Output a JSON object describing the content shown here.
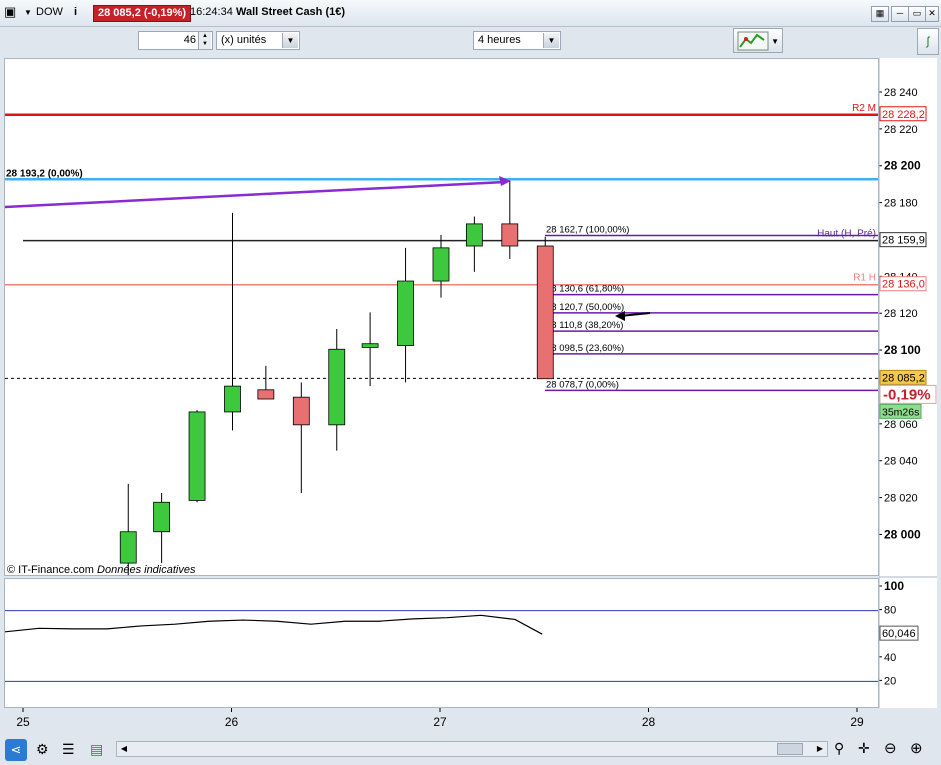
{
  "title_bar": {
    "symbol": "DOW",
    "info_icon": "info-icon",
    "price_change": "28 085,2 (-0,19%)",
    "time": "16:24:34",
    "instrument": "Wall Street Cash (1€)"
  },
  "toolbar": {
    "quantity_value": "46",
    "unit_label": "(x) unités",
    "timeframe_label": "4 heures",
    "strategy_icon": "chart-strategy-icon"
  },
  "chart_data": {
    "type": "candlestick",
    "y_axis_labels": [
      "28 240",
      "28 220",
      "28 200",
      "28 180",
      "28 160",
      "28 140",
      "28 120",
      "28 100",
      "28 060",
      "28 040",
      "28 020",
      "28 000"
    ],
    "x_axis_labels": [
      "25",
      "26",
      "27",
      "28",
      "29"
    ],
    "ylim": [
      27990,
      28250
    ],
    "candles": [
      {
        "x": 25.5,
        "open": 27985,
        "high": 28028,
        "low": 27975,
        "close": 28002
      },
      {
        "x": 25.66,
        "open": 28002,
        "high": 28023,
        "low": 27985,
        "close": 28018
      },
      {
        "x": 25.83,
        "open": 28019,
        "high": 28068,
        "low": 28018,
        "close": 28067
      },
      {
        "x": 26.0,
        "open": 28067,
        "high": 28175,
        "low": 28057,
        "close": 28081
      },
      {
        "x": 26.16,
        "open": 28079,
        "high": 28092,
        "low": 28074,
        "close": 28074
      },
      {
        "x": 26.33,
        "open": 28075,
        "high": 28083,
        "low": 28023,
        "close": 28060
      },
      {
        "x": 26.5,
        "open": 28060,
        "high": 28112,
        "low": 28046,
        "close": 28101
      },
      {
        "x": 26.66,
        "open": 28102,
        "high": 28121,
        "low": 28081,
        "close": 28104
      },
      {
        "x": 26.83,
        "open": 28103,
        "high": 28156,
        "low": 28083,
        "close": 28138
      },
      {
        "x": 27.0,
        "open": 28138,
        "high": 28163,
        "low": 28129,
        "close": 28156
      },
      {
        "x": 27.16,
        "open": 28157,
        "high": 28173,
        "low": 28143,
        "close": 28169
      },
      {
        "x": 27.33,
        "open": 28169,
        "high": 28192,
        "low": 28150,
        "close": 28157
      },
      {
        "x": 27.5,
        "open": 28157,
        "high": 28162,
        "low": 28085,
        "close": 28085
      }
    ],
    "levels": [
      {
        "name": "R2 M",
        "value": 28228.2,
        "label": "28 228,2",
        "color": "#e01414"
      },
      {
        "name": "",
        "value": 28193.2,
        "label": "28 193,2 (0,00%)",
        "color": "#3eb2f0"
      },
      {
        "name": "Haut (H, Pré)",
        "value": 28159.9,
        "label": "28 159,9",
        "color": "#222222"
      },
      {
        "name": "R1 H",
        "value": 28136.0,
        "label": "28 136,0",
        "color": "#f08080"
      }
    ],
    "fibonacci": [
      {
        "value": 28162.7,
        "label": "28 162,7 (100,00%)"
      },
      {
        "value": 28130.6,
        "label": "28 130,6 (61,80%)"
      },
      {
        "value": 28120.7,
        "label": "28 120,7 (50,00%)"
      },
      {
        "value": 28110.8,
        "label": "28 110,8 (38,20%)"
      },
      {
        "value": 28098.5,
        "label": "28 098,5 (23,60%)"
      },
      {
        "value": 28078.7,
        "label": "28 078,7 (0,00%)"
      }
    ],
    "current_price": {
      "value": 28085.2,
      "label": "28 085,2",
      "change": "-0,19%",
      "countdown": "35m26s"
    },
    "indicator": {
      "axis_labels": [
        "100",
        "80",
        "60",
        "40",
        "20"
      ],
      "value_label": "60,046",
      "levels": [
        80,
        20
      ],
      "line": [
        62,
        65,
        64.5,
        64.5,
        67,
        68.5,
        71,
        72,
        71,
        68.5,
        71,
        71,
        73,
        74,
        76,
        72.5,
        60
      ]
    }
  },
  "watermark": "© IT-Finance.com",
  "watermark_note": "Données indicatives"
}
